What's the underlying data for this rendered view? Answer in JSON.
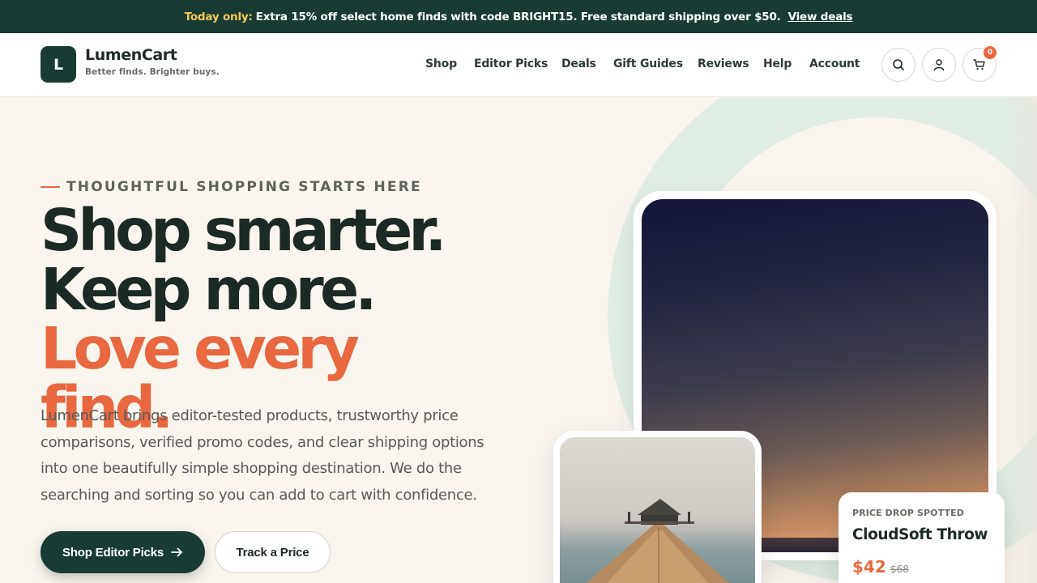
{
  "promo": {
    "highlight": "Today only:",
    "message": "Extra 15% off select home finds with code BRIGHT15. Free standard shipping over $50.",
    "link": "View deals"
  },
  "header": {
    "logo_letter": "L",
    "brand": "LumenCart",
    "tagline": "Better finds. Brighter buys.",
    "nav": [
      "Shop",
      "Editor Picks",
      "Deals",
      "Gift Guides",
      "Reviews",
      "Help",
      "Account"
    ],
    "cart_count": "0",
    "icons": [
      "search-icon",
      "user-icon",
      "cart-icon"
    ]
  },
  "hero": {
    "eyebrow": "THOUGHTFUL SHOPPING STARTS HERE",
    "headline_line1": "Shop smarter.",
    "headline_line2": "Keep more.",
    "headline_accent": "Love every find.",
    "lede": "LumenCart brings editor-tested products, trustworthy price comparisons, verified promo codes, and clear shipping options into one beautifully simple shopping destination. We do the searching and sorting so you can add to cart with confidence.",
    "primary_cta": "Shop Editor Picks",
    "primary_cta_icon": "arrow-right-icon",
    "secondary_cta": "Track a Price"
  },
  "price_card": {
    "label": "PRICE DROP SPOTTED",
    "product": "CloudSoft Throw",
    "price": "$42",
    "old_price": "$68"
  },
  "colors": {
    "brand_dark": "#193b33",
    "accent": "#e8693f",
    "promo_highlight": "#f5c95b",
    "background": "#faf5ee"
  }
}
